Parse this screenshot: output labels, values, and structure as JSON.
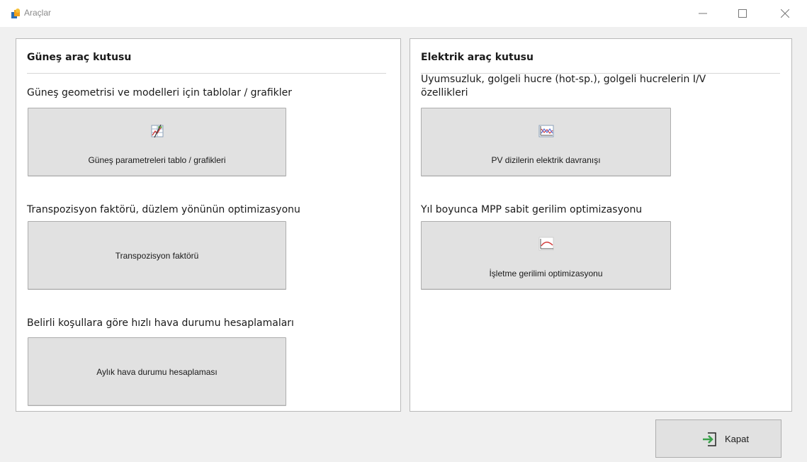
{
  "window": {
    "title": "Araçlar"
  },
  "left_panel": {
    "title": "Güneş araç kutusu",
    "sections": [
      {
        "description": "Güneş geometrisi ve modelleri için tablolar / grafikler",
        "button_label": "Güneş parametreleri tablo / grafikleri",
        "icon": "table-chart-icon"
      },
      {
        "description": "Transpozisyon faktörü, düzlem yönünün optimizasyonu",
        "button_label": "Transpozisyon faktörü",
        "icon": ""
      },
      {
        "description": "Belirli koşullara göre hızlı hava durumu hesaplamaları",
        "button_label": "Aylık hava durumu hesaplaması",
        "icon": ""
      }
    ]
  },
  "right_panel": {
    "title": "Elektrik araç kutusu",
    "sections": [
      {
        "description_line1": "Uyumsuzluk, golgeli hucre (hot-sp.), golgeli hucrelerin I/V",
        "description_line2": "özellikleri",
        "button_label": "PV dizilerin elektrik davranışı",
        "icon": "iv-curve-chart-icon"
      },
      {
        "description": "Yıl boyunca MPP sabit gerilim optimizasyonu",
        "button_label": "İşletme gerilimi optimizasyonu",
        "icon": "mpp-curve-icon"
      }
    ]
  },
  "footer": {
    "close_label": "Kapat",
    "close_icon": "exit-arrow-icon"
  },
  "colors": {
    "window_bg": "#f0f0f0",
    "button_bg": "#e1e1e1",
    "panel_border": "#b9b9b9",
    "accent_green": "#3aa04a"
  }
}
